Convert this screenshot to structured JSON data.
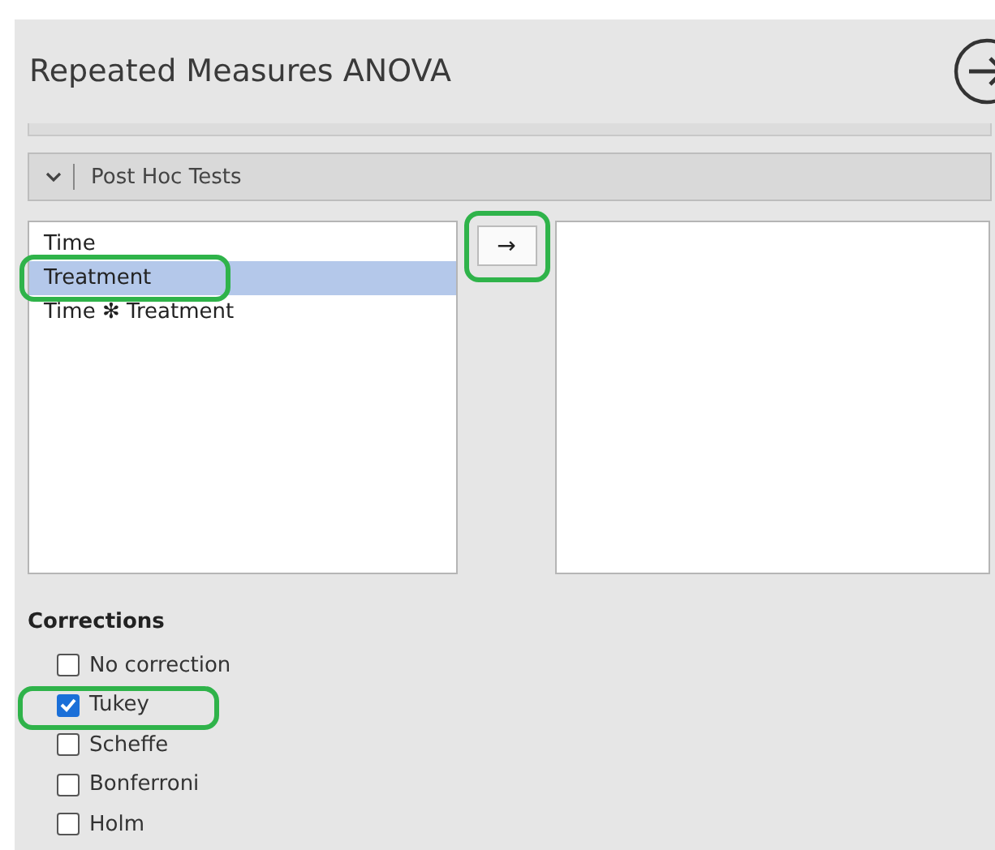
{
  "title": "Repeated Measures ANOVA",
  "section": {
    "label": "Post Hoc Tests",
    "expanded": true
  },
  "available_terms": [
    {
      "label": "Time",
      "selected": false,
      "annotated": false
    },
    {
      "label": "Treatment",
      "selected": true,
      "annotated": true
    },
    {
      "label": "Time ✻ Treatment",
      "selected": false,
      "annotated": false
    }
  ],
  "move_button": {
    "label": "→",
    "annotated": true
  },
  "corrections": {
    "heading": "Corrections",
    "options": [
      {
        "label": "No correction",
        "checked": false,
        "annotated": false
      },
      {
        "label": "Tukey",
        "checked": true,
        "annotated": true
      },
      {
        "label": "Scheffe",
        "checked": false,
        "annotated": false
      },
      {
        "label": "Bonferroni",
        "checked": false,
        "annotated": false
      },
      {
        "label": "Holm",
        "checked": false,
        "annotated": false
      }
    ]
  }
}
